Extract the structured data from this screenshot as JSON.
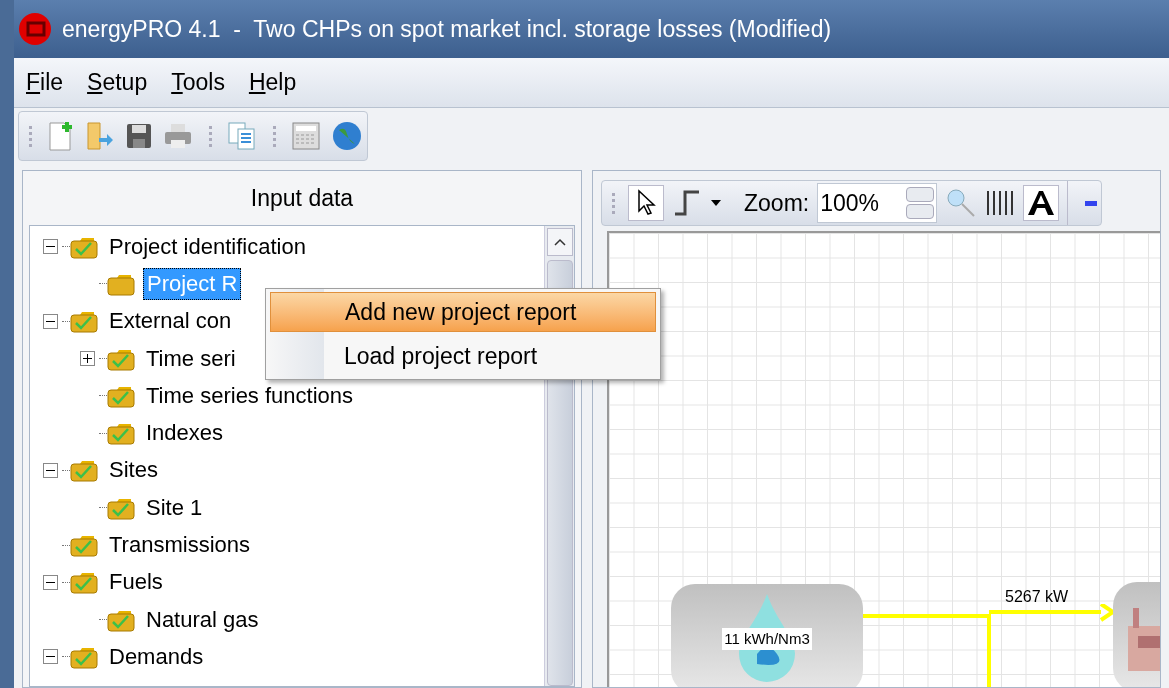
{
  "window": {
    "title": "energyPRO 4.1  -  Two CHPs on spot market incl. storage losses (Modified)"
  },
  "menu": [
    {
      "label": "File"
    },
    {
      "label": "Setup"
    },
    {
      "label": "Tools"
    },
    {
      "label": "Help"
    }
  ],
  "input_panel": {
    "title": "Input data",
    "tree": [
      {
        "label": "Project identification",
        "checked": true,
        "selected": false,
        "expanded": true,
        "children": [
          {
            "label": "Project R",
            "checked": false,
            "selected": true
          }
        ]
      },
      {
        "label": "External con",
        "checked": true,
        "selected": false,
        "expanded": true,
        "children": [
          {
            "label": "Time seri",
            "checked": true,
            "selected": false,
            "expanded": false
          },
          {
            "label": "Time series functions",
            "checked": true,
            "selected": false
          },
          {
            "label": "Indexes",
            "checked": true,
            "selected": false
          }
        ]
      },
      {
        "label": "Sites",
        "checked": true,
        "selected": false,
        "expanded": true,
        "children": [
          {
            "label": "Site 1",
            "checked": true,
            "selected": false
          }
        ]
      },
      {
        "label": "Transmissions",
        "checked": true,
        "selected": false
      },
      {
        "label": "Fuels",
        "checked": true,
        "selected": false,
        "expanded": true,
        "children": [
          {
            "label": "Natural gas",
            "checked": true,
            "selected": false
          }
        ]
      },
      {
        "label": "Demands",
        "checked": true,
        "selected": false,
        "expanded": true
      }
    ]
  },
  "context_menu": [
    {
      "label": "Add new project report",
      "selected": true
    },
    {
      "label": "Load project report",
      "selected": false
    }
  ],
  "diagram_toolbar": {
    "zoom_label": "Zoom:",
    "zoom_value": "100%"
  },
  "diagram": {
    "fuel_label": "11 kWh/Nm3",
    "flow_label": "5267 kW"
  }
}
